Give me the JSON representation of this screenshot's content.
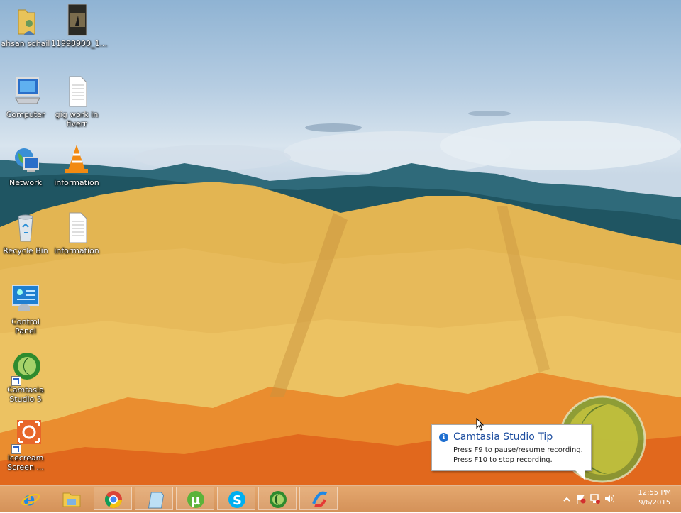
{
  "desktop": {
    "icons": [
      {
        "label": "ahsan sohail"
      },
      {
        "label": "11998900_1..."
      },
      {
        "label": "Computer"
      },
      {
        "label": "gig work in fiverr"
      },
      {
        "label": "Network"
      },
      {
        "label": "information"
      },
      {
        "label": "Recycle Bin"
      },
      {
        "label": "information"
      },
      {
        "label": "Control Panel"
      },
      {
        "label": "Camtasia Studio 5"
      },
      {
        "label": "Icecream Screen ..."
      }
    ]
  },
  "tooltip": {
    "title": "Camtasia Studio Tip",
    "line1": "Press F9 to pause/resume recording.",
    "line2": "Press F10 to stop recording."
  },
  "taskbar": {
    "buttons": [
      {
        "icon": "internet-explorer-icon"
      },
      {
        "icon": "file-explorer-icon"
      },
      {
        "icon": "chrome-icon"
      },
      {
        "icon": "notepad-icon"
      },
      {
        "icon": "utorrent-icon"
      },
      {
        "icon": "skype-icon"
      },
      {
        "icon": "camtasia-icon"
      },
      {
        "icon": "app-icon"
      }
    ],
    "clock": {
      "time": "12:55 PM",
      "date": "9/6/2015"
    }
  },
  "colors": {
    "taskbar": "#d9925a",
    "tip_title": "#1f4fa0",
    "info": "#1f6fd0"
  }
}
